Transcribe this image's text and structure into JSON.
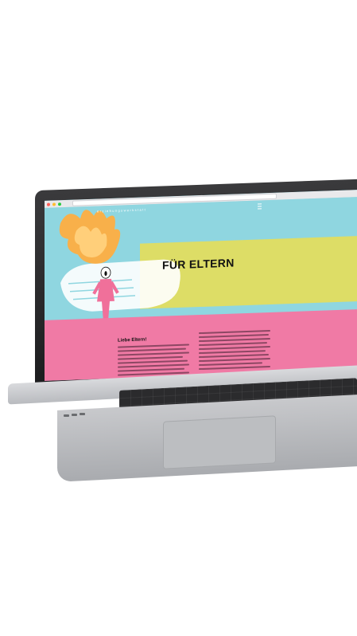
{
  "browser": {
    "dot_colors": [
      "#ff5f57",
      "#febc2e",
      "#28c840"
    ]
  },
  "site": {
    "brand": "erziehungswerkstatt",
    "hero_title": "FÜR ELTERN",
    "intro_heading": "Liebe Eltern!",
    "menu_icon": "hamburger-menu-icon"
  },
  "colors": {
    "hero_bg": "#8fd6e0",
    "band": "#dddd66",
    "pink": "#f07aa5",
    "flame": "#f8b04a",
    "figure": "#f0709a"
  }
}
